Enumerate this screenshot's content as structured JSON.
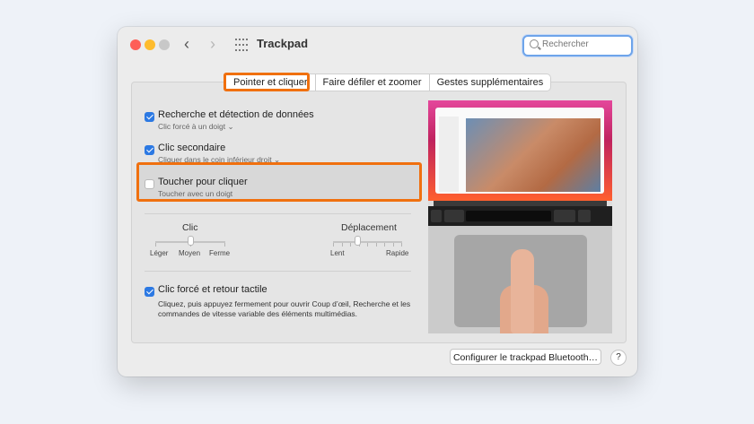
{
  "window": {
    "title": "Trackpad",
    "search_placeholder": "Rechercher"
  },
  "tabs": [
    {
      "label": "Pointer et cliquer",
      "selected": true
    },
    {
      "label": "Faire défiler et zoomer",
      "selected": false
    },
    {
      "label": "Gestes supplémentaires",
      "selected": false
    }
  ],
  "options": {
    "lookup": {
      "label": "Recherche et détection de données",
      "sub": "Clic forcé à un doigt ⌄",
      "checked": true
    },
    "secondary": {
      "label": "Clic secondaire",
      "sub": "Cliquer dans le coin inférieur droit ⌄",
      "checked": true
    },
    "tap": {
      "label": "Toucher pour cliquer",
      "sub": "Toucher avec un doigt",
      "checked": false
    },
    "force": {
      "label": "Clic forcé et retour tactile",
      "checked": true,
      "description": "Cliquez, puis appuyez fermement pour ouvrir Coup d’œil, Recherche et les commandes de vitesse variable des éléments multimédias."
    }
  },
  "sliders": {
    "click": {
      "title": "Clic",
      "left": "Léger",
      "mid": "Moyen",
      "right": "Ferme",
      "value_fraction": 0.5
    },
    "tracking": {
      "title": "Déplacement",
      "left": "Lent",
      "right": "Rapide",
      "value_fraction": 0.3
    }
  },
  "buttons": {
    "configure": "Configurer le trackpad Bluetooth…",
    "help": "?"
  },
  "colors": {
    "accent": "#2c79e3",
    "highlight": "#f0700f"
  }
}
